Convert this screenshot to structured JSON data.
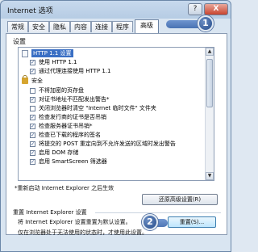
{
  "window": {
    "title": "Internet 选项",
    "help_glyph": "?",
    "close_glyph": "X"
  },
  "tabs": [
    {
      "label": "常规"
    },
    {
      "label": "安全"
    },
    {
      "label": "隐私"
    },
    {
      "label": "内容"
    },
    {
      "label": "连接"
    },
    {
      "label": "程序"
    },
    {
      "label": "高级"
    }
  ],
  "settings": {
    "group_label": "设置",
    "items": [
      {
        "text": "HTTP 1.1 设置",
        "kind": "page",
        "selected": true
      },
      {
        "text": "使用 HTTP 1.1",
        "kind": "check",
        "checked": true
      },
      {
        "text": "通过代理连接使用 HTTP 1.1",
        "kind": "check",
        "checked": true
      },
      {
        "text": "安全",
        "kind": "lock"
      },
      {
        "text": "不将加密的页存盘",
        "kind": "check",
        "checked": false
      },
      {
        "text": "对证书地址不匹配发出警告*",
        "kind": "check",
        "checked": true
      },
      {
        "text": "关闭浏览器时清空 \"Internet 临时文件\" 文件夹",
        "kind": "check",
        "checked": false
      },
      {
        "text": "检查发行商的证书是否吊销",
        "kind": "check",
        "checked": true
      },
      {
        "text": "检查服务器证书吊销*",
        "kind": "check",
        "checked": true
      },
      {
        "text": "检查已下载的程序的签名",
        "kind": "check",
        "checked": true
      },
      {
        "text": "将提交的 POST 重定向到不允许发送的区域时发出警告",
        "kind": "check",
        "checked": true
      },
      {
        "text": "启用 DOM 存储",
        "kind": "check",
        "checked": true
      },
      {
        "text": "启用 SmartScreen 筛选器",
        "kind": "check",
        "checked": true
      }
    ],
    "scroll_up": "▲",
    "scroll_down": "▼",
    "footnote": "*重新启动 Internet Explorer 之后生效",
    "restore_button": "还原高级设置(R)"
  },
  "reset": {
    "group_label": "重置 Internet Explorer 设置",
    "description": "将 Internet Explorer 设置重置为默认设置。",
    "button": "重置(S)...",
    "note": "仅在浏览器处于无法使用的状态时，才使用此设置。"
  },
  "callouts": [
    {
      "number": "1"
    },
    {
      "number": "2"
    }
  ]
}
